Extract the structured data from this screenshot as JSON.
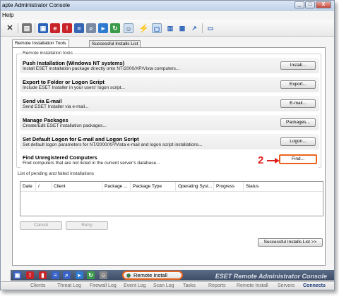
{
  "window": {
    "title": "apte Administrator Console",
    "min": "_",
    "max": "□",
    "close": "X"
  },
  "menu": {
    "help": "Help"
  },
  "toolbar": {
    "icons": [
      "close-icon",
      "print-icon",
      "copy-icon",
      "eset-logo-icon",
      "stop-icon",
      "report-icon",
      "search-icon",
      "play-icon",
      "refresh-icon",
      "user-icon",
      "remote-install-icon",
      "sync-icon",
      "window-icon",
      "panel-icon",
      "columns-icon",
      "arrow-icon",
      "info-icon"
    ]
  },
  "tabs": [
    {
      "label": "Remote Installation Tools",
      "active": true
    },
    {
      "label": "Successful Installs List",
      "active": false
    }
  ],
  "group": {
    "label": "Remote installation tools",
    "items": [
      {
        "title": "Push Installation (Windows NT systems)",
        "desc": "Install ESET installation package directly onto NT/2000/XP/Vista computers...",
        "button": "Install..."
      },
      {
        "title": "Export to Folder or Logon Script",
        "desc": "Include ESET Installer in your users' logon script...",
        "button": "Export..."
      },
      {
        "title": "Send via E-mail",
        "desc": "Send ESET Installer via e-mail...",
        "button": "E-mail..."
      },
      {
        "title": "Manage Packages",
        "desc": "Create/Edit ESET installation packages...",
        "button": "Packages..."
      },
      {
        "title": "Set Default Logon for E-mail and Logon Script",
        "desc": "Set default logon parameters for NT/2000/XP/Vista e-mail and logon script installations...",
        "button": "Logon..."
      },
      {
        "title": "Find Unregistered Computers",
        "desc": "Find computers that are not listed in the current server's database...",
        "button": "Find..."
      }
    ]
  },
  "annotation": {
    "step": "2"
  },
  "list": {
    "label": "List of pending and failed installations",
    "columns": [
      "Date",
      "/",
      "Client",
      "Package ...",
      "Package Type",
      "Operating Syst...",
      "Progress",
      "Status"
    ]
  },
  "buttons": {
    "cancel": "Cancel",
    "retry": "Retry",
    "successful_list": "Successful Installs List >>"
  },
  "bottom": {
    "remote_install": "Remote Install",
    "brand": "ESET Remote Administrator Console"
  },
  "statusbar": [
    "Clients",
    "Threat Log",
    "Firewall Log",
    "Event Log",
    "Scan Log",
    "Tasks",
    "Reports",
    "Remote Install",
    "Servers",
    "Connects"
  ],
  "colors": {
    "highlight": "#e8641e",
    "marker": "#e02020"
  }
}
